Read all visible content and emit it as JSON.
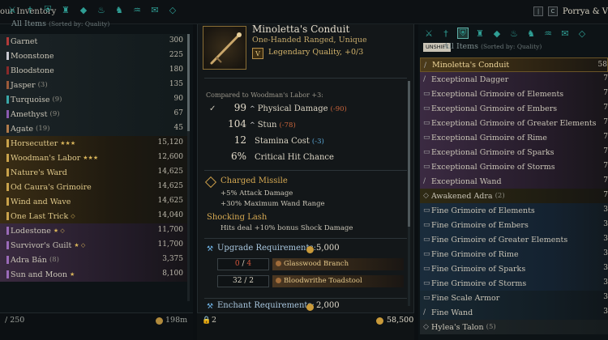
{
  "header": {
    "inventory_title": "our Inventory",
    "char_key": "C",
    "char_name": "Porrya & V",
    "left_key": "|"
  },
  "left_panel": {
    "category_icons": [
      "all-items-icon",
      "weapon-icon",
      "shield-icon",
      "armor-icon",
      "gem-icon",
      "potion-icon",
      "horse-icon",
      "lamp-icon",
      "quest-icon",
      "misc-icon"
    ],
    "label": "All Items",
    "sort_label": "(Sorted by: Quality)",
    "items": [
      {
        "name": "Garnet",
        "count": "",
        "value": "300",
        "style": "gem",
        "marker": "#b23a3a"
      },
      {
        "name": "Moonstone",
        "count": "",
        "value": "225",
        "style": "gem",
        "marker": "#c8c8d0"
      },
      {
        "name": "Bloodstone",
        "count": "",
        "value": "180",
        "style": "gem",
        "marker": "#8a2a2a"
      },
      {
        "name": "Jasper",
        "count": "(3)",
        "value": "135",
        "style": "gem",
        "marker": "#9b5a3a"
      },
      {
        "name": "Turquoise",
        "count": "(9)",
        "value": "90",
        "style": "gem",
        "marker": "#3aa8a8"
      },
      {
        "name": "Amethyst",
        "count": "(9)",
        "value": "67",
        "style": "gem",
        "marker": "#8a5ab0"
      },
      {
        "name": "Agate",
        "count": "(19)",
        "value": "45",
        "style": "gem",
        "marker": "#b07a4a"
      },
      {
        "name": "Horsecutter",
        "count": "",
        "stars": "★★★",
        "value": "15,120",
        "style": "gold",
        "marker": "#c9a24a"
      },
      {
        "name": "Woodman's Labor",
        "count": "",
        "stars": "★★★",
        "value": "12,600",
        "style": "gold",
        "marker": "#c9a24a"
      },
      {
        "name": "Nature's Ward",
        "count": "",
        "value": "14,625",
        "style": "gold",
        "marker": "#c9a24a"
      },
      {
        "name": "Od Caura's Grimoire",
        "count": "",
        "value": "14,625",
        "style": "gold",
        "marker": "#c9a24a"
      },
      {
        "name": "Wind and Wave",
        "count": "",
        "value": "14,625",
        "style": "gold",
        "marker": "#c9a24a"
      },
      {
        "name": "One Last Trick",
        "count": "",
        "stars": "◇",
        "value": "14,040",
        "style": "gold",
        "marker": "#c9a24a"
      },
      {
        "name": "Lodestone",
        "count": "",
        "stars": "★ ◇",
        "value": "11,700",
        "style": "purple",
        "marker": "#9a6ab8"
      },
      {
        "name": "Survivor's Guilt",
        "count": "",
        "stars": "★ ◇",
        "value": "11,700",
        "style": "purple",
        "marker": "#9a6ab8"
      },
      {
        "name": "Adra Bán",
        "count": "(8)",
        "value": "3,375",
        "style": "purple",
        "marker": "#9a6ab8"
      },
      {
        "name": "Sun and Moon",
        "count": "",
        "stars": "★",
        "value": "8,100",
        "style": "purple",
        "marker": "#9a6ab8"
      }
    ],
    "capacity": "/ 250",
    "weight": "198m"
  },
  "tooltip": {
    "item_name": "Minoletta's Conduit",
    "item_type": "One-Handed Ranged, Unique",
    "quality_badge": "V",
    "quality_text": "Legendary Quality, +0/3",
    "compare_label": "Compared to Woodman's Labor +3:",
    "stats": [
      {
        "check": "✓",
        "value": "99",
        "arrow": "^",
        "label": "Physical Damage",
        "delta": "(-90)",
        "delta_class": "neg"
      },
      {
        "check": "",
        "value": "104",
        "arrow": "^",
        "label": "Stun",
        "delta": "(-78)",
        "delta_class": "neg"
      },
      {
        "check": "",
        "value": "12",
        "arrow": "",
        "label": "Stamina Cost",
        "delta": "(-3)",
        "delta_class": "posb"
      },
      {
        "check": "",
        "value": "6%",
        "arrow": "",
        "label": "Critical Hit Chance",
        "delta": "",
        "delta_class": ""
      }
    ],
    "perk1_name": "Charged Missile",
    "perk1_line1": "+5% Attack Damage",
    "perk1_line2": "+30% Maximum Wand Range",
    "perk2_name": "Shocking Lash",
    "perk2_line1": "Hits deal +10% bonus Shock Damage",
    "upgrade_label": "Upgrade Requirements:",
    "upgrade_gold": "5,000",
    "materials": [
      {
        "have": "0",
        "need": "4",
        "name": "Glasswood Branch",
        "lacking": true
      },
      {
        "have": "32",
        "need": "2",
        "name": "Bloodwrithe Toadstool",
        "lacking": false
      }
    ],
    "enchant_label": "Enchant Requirements:",
    "enchant_gold": "2,000",
    "lock_count": "2",
    "wallet_gold": "58,500"
  },
  "right_panel": {
    "category_icons": [
      "all-items-icon",
      "weapon-icon",
      "shield-icon",
      "armor-icon",
      "gem-icon",
      "potion-icon",
      "horse-icon",
      "lamp-icon",
      "quest-icon",
      "misc-icon"
    ],
    "unshift_key": "UNSHIFT",
    "label": "All Items",
    "sort_label": "(Sorted by: Quality)",
    "items": [
      {
        "name": "Minoletta's Conduit",
        "count": "",
        "value": "58",
        "style": "gold",
        "tool": "/"
      },
      {
        "name": "Exceptional Dagger",
        "count": "",
        "value": "7",
        "style": "purple",
        "tool": "/"
      },
      {
        "name": "Exceptional Grimoire of Elements",
        "count": "",
        "value": "7",
        "style": "purple",
        "tool": "▭"
      },
      {
        "name": "Exceptional Grimoire of Embers",
        "count": "",
        "value": "7",
        "style": "purple",
        "tool": "▭"
      },
      {
        "name": "Exceptional Grimoire of Greater Elements",
        "count": "",
        "value": "7",
        "style": "purple",
        "tool": "▭"
      },
      {
        "name": "Exceptional Grimoire of Rime",
        "count": "",
        "value": "7",
        "style": "purple",
        "tool": "▭"
      },
      {
        "name": "Exceptional Grimoire of Sparks",
        "count": "",
        "value": "7",
        "style": "purple",
        "tool": "▭"
      },
      {
        "name": "Exceptional Grimoire of Storms",
        "count": "",
        "value": "7",
        "style": "purple",
        "tool": "▭"
      },
      {
        "name": "Exceptional Wand",
        "count": "",
        "value": "7",
        "style": "purple",
        "tool": "/"
      },
      {
        "name": "Awakened Adra",
        "count": "(2)",
        "value": "7",
        "style": "yel",
        "tool": "◇"
      },
      {
        "name": "Fine Grimoire of Elements",
        "count": "",
        "value": "3",
        "style": "blue",
        "tool": "▭"
      },
      {
        "name": "Fine Grimoire of Embers",
        "count": "",
        "value": "3",
        "style": "blue",
        "tool": "▭"
      },
      {
        "name": "Fine Grimoire of Greater Elements",
        "count": "",
        "value": "3",
        "style": "blue",
        "tool": "▭"
      },
      {
        "name": "Fine Grimoire of Rime",
        "count": "",
        "value": "3",
        "style": "blue",
        "tool": "▭"
      },
      {
        "name": "Fine Grimoire of Sparks",
        "count": "",
        "value": "3",
        "style": "blue",
        "tool": "▭"
      },
      {
        "name": "Fine Grimoire of Storms",
        "count": "",
        "value": "3",
        "style": "blue",
        "tool": "▭"
      },
      {
        "name": "Fine Scale Armor",
        "count": "",
        "value": "3",
        "style": "blue2",
        "tool": "▭"
      },
      {
        "name": "Fine Wand",
        "count": "",
        "value": "3",
        "style": "blue2",
        "tool": "/"
      },
      {
        "name": "Hylea's Talon",
        "count": "(5)",
        "value": "",
        "style": "gray",
        "tool": "◇"
      }
    ]
  }
}
